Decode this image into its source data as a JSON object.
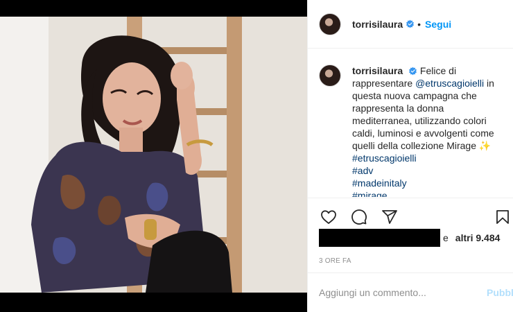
{
  "post": {
    "username": "torrisilaura",
    "follow_label": "Segui",
    "separator": "•",
    "caption": {
      "username": "torrisilaura",
      "text_1": "Felice di rappresentare ",
      "mention": "@etruscagioielli",
      "text_2": " in questa nuova campagna che rappresenta la donna mediterranea, utilizzando colori caldi, luminosi e avvolgenti come quelli della collezione Mirage ✨",
      "hashtags": [
        "#etruscagioielli",
        "#adv",
        "#madeinitaly",
        "#mirage"
      ]
    },
    "likes": {
      "connector": "e",
      "others": "altri 9.484"
    },
    "timestamp": "3 ore fa",
    "comment": {
      "placeholder": "Aggiungi un commento...",
      "publish_label": "Pubblica"
    }
  },
  "icons": {
    "like": "heart-icon",
    "comment": "comment-icon",
    "share": "share-icon",
    "save": "bookmark-icon",
    "verified": "verified-badge-icon"
  },
  "colors": {
    "accent": "#0095f6",
    "link": "#00376b",
    "muted": "#8e8e8e",
    "publish_disabled": "#b2dffc"
  }
}
